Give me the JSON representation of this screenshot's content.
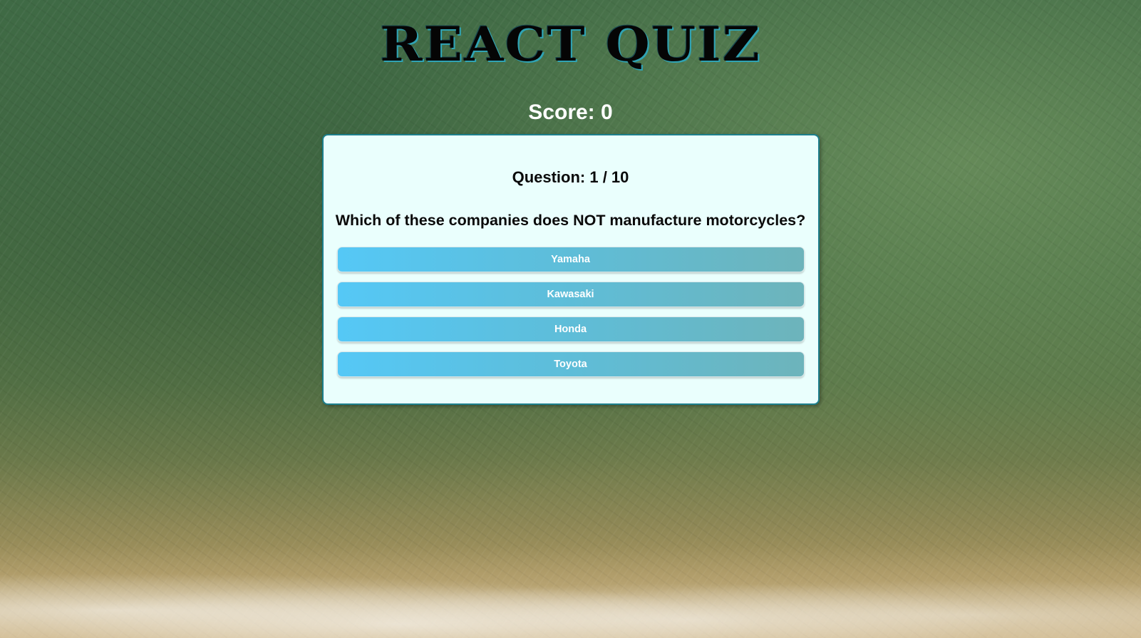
{
  "app": {
    "title": "REACT QUIZ",
    "score_text": "Score: 0"
  },
  "quiz": {
    "question_counter": "Question: 1 / 10",
    "question": "Which of these companies does NOT manufacture motorcycles?",
    "answers": [
      "Yamaha",
      "Kawasaki",
      "Honda",
      "Toyota"
    ]
  },
  "colors": {
    "title_text": "#050505",
    "title_outline": "#2fa3b4",
    "card_background": "#eafffd",
    "card_border": "#1d7f8c",
    "answer_gradient_start": "#55c8f6",
    "answer_gradient_end": "#6db4bb",
    "answer_text": "#ffffff"
  }
}
